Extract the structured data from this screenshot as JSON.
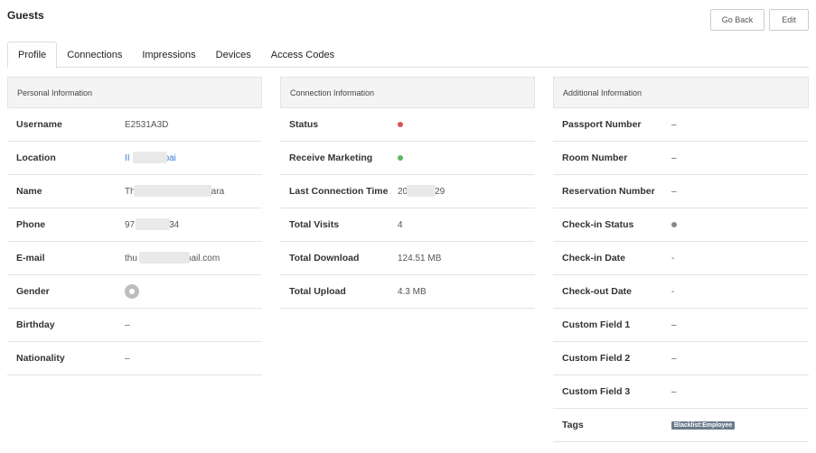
{
  "page": {
    "title": "Guests"
  },
  "toolbar": {
    "go_back_label": "Go Back",
    "edit_label": "Edit"
  },
  "tabs": [
    {
      "label": "Profile",
      "active": true
    },
    {
      "label": "Connections",
      "active": false
    },
    {
      "label": "Impressions",
      "active": false
    },
    {
      "label": "Devices",
      "active": false
    },
    {
      "label": "Access Codes",
      "active": false
    }
  ],
  "personal": {
    "header": "Personal Information",
    "username": {
      "label": "Username",
      "value": "E2531A3D"
    },
    "location": {
      "label": "Location",
      "value_start": "II",
      "value_end": "bai"
    },
    "name": {
      "label": "Name",
      "value_start": "Th",
      "value_end": "ara"
    },
    "phone": {
      "label": "Phone",
      "value_start": "97",
      "value_end": "34"
    },
    "email": {
      "label": "E-mail",
      "value_start": "thu",
      "value_end": "nail.com"
    },
    "gender": {
      "label": "Gender",
      "icon": "gender-unknown-icon"
    },
    "birthday": {
      "label": "Birthday",
      "value": "–"
    },
    "nationality": {
      "label": "Nationality",
      "value": "–"
    }
  },
  "connection": {
    "header": "Connection Information",
    "status": {
      "label": "Status",
      "indicator_color": "#d9534f"
    },
    "receive_marketing": {
      "label": "Receive Marketing",
      "indicator_color": "#5cb85c"
    },
    "last_connection": {
      "label": "Last Connection Time",
      "value_start": "20",
      "value_end": "29"
    },
    "total_visits": {
      "label": "Total Visits",
      "value": "4"
    },
    "total_download": {
      "label": "Total Download",
      "value": "124.51 MB"
    },
    "total_upload": {
      "label": "Total Upload",
      "value": "4.3 MB"
    }
  },
  "additional": {
    "header": "Additional Information",
    "passport": {
      "label": "Passport Number",
      "value": "–"
    },
    "room": {
      "label": "Room Number",
      "value": "–"
    },
    "reservation": {
      "label": "Reservation Number",
      "value": "–"
    },
    "checkin_status": {
      "label": "Check-in Status",
      "indicator_color": "#888888"
    },
    "checkin_date": {
      "label": "Check-in Date",
      "value": "-"
    },
    "checkout_date": {
      "label": "Check-out Date",
      "value": "-"
    },
    "custom1": {
      "label": "Custom Field 1",
      "value": "–"
    },
    "custom2": {
      "label": "Custom Field 2",
      "value": "–"
    },
    "custom3": {
      "label": "Custom Field 3",
      "value": "–"
    },
    "tags": {
      "label": "Tags",
      "value": "Blacklist:Employee"
    }
  }
}
